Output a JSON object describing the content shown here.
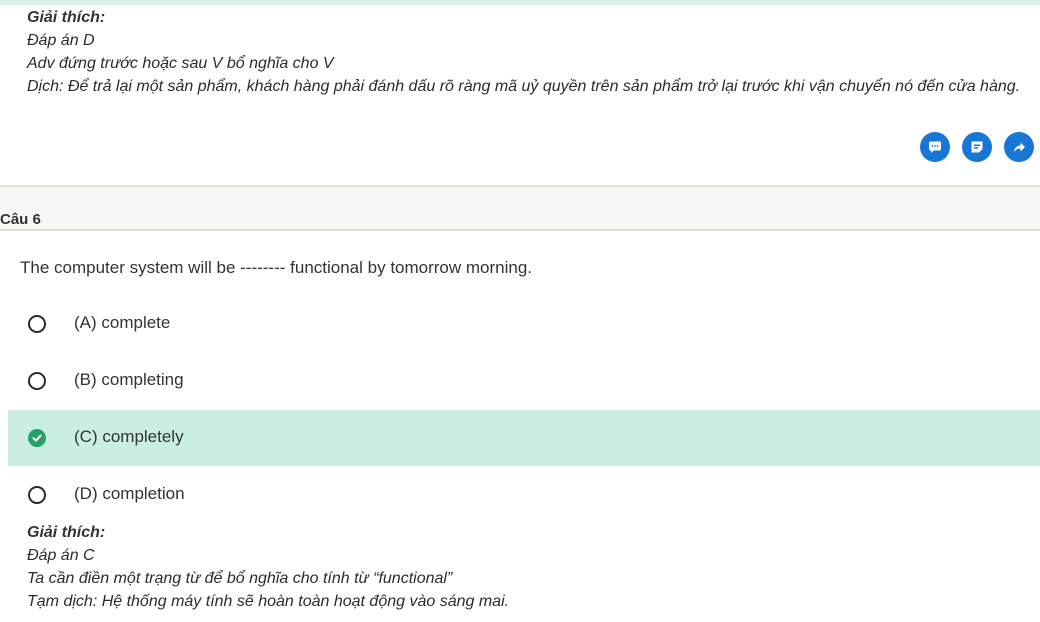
{
  "previous_explanation": {
    "heading": "Giải thích:",
    "answer": "Đáp án D",
    "note": "Adv đứng trước hoặc sau V bổ nghĩa cho V",
    "translation": "Dịch: Để trả lại một sản phẩm, khách hàng phải đánh dấu rõ ràng mã uỷ quyền trên sản phẩm trở lại trước khi vận chuyển nó đến cửa hàng."
  },
  "actions": [
    {
      "icon": "comment-icon"
    },
    {
      "icon": "note-icon"
    },
    {
      "icon": "share-icon"
    }
  ],
  "colors": {
    "accent": "#1877d5",
    "selected_bg": "#cbeee2",
    "correct": "#26a269"
  },
  "question": {
    "label": "Câu 6",
    "text": "The computer system will be -------- functional by tomorrow morning.",
    "options": [
      {
        "label": "(A) complete",
        "selected": false
      },
      {
        "label": "(B) completing",
        "selected": false
      },
      {
        "label": "(C) completely",
        "selected": true
      },
      {
        "label": "(D) completion",
        "selected": false
      }
    ]
  },
  "explanation": {
    "heading": "Giải thích:",
    "answer": "Đáp án C",
    "note": "Ta cần điền một trạng từ để bổ nghĩa cho tính từ “functional”",
    "translation": "Tạm dịch: Hệ thống máy tính sẽ hoàn toàn hoạt động vào sáng mai."
  }
}
